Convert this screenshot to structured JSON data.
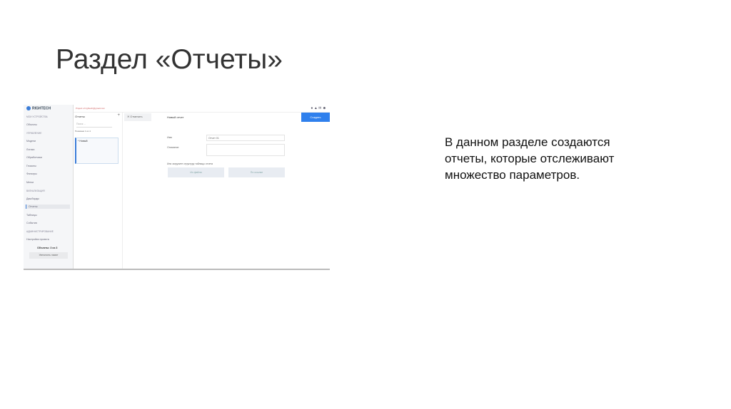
{
  "slide": {
    "title": "Раздел «Отчеты»",
    "description": "В данном разделе создаются отчеты, которые отслеживают множество параметров."
  },
  "app": {
    "logo": "RIGHTECH",
    "project": "Project of rightech@gmail.com",
    "sidebar": {
      "sections": [
        "МОИ УСТРОЙСТВА",
        "УПРАВЛЕНИЕ",
        "ВИЗУАЛИЗАЦИЯ",
        "АДМИНИСТРИРОВАНИЕ"
      ],
      "items": [
        "Объекты",
        "Модели",
        "Логика",
        "Обработчики",
        "Геозоны",
        "Фильтры",
        "Метки",
        "Дашборды",
        "Отчеты",
        "Таблицы",
        "События",
        "Настройки проекта"
      ],
      "objects_count": "Объекты: 3 из 3",
      "limit_button": "Увеличить лимит"
    },
    "list": {
      "title": "Отчеты",
      "search_placeholder": "Поиск ...",
      "shown": "Показано 1 из 1",
      "item": "* Новый"
    },
    "main": {
      "cancel": "Отменить",
      "header": "Новый отчет",
      "create": "Создать",
      "name_label": "Имя",
      "name_value": "Отчет 01",
      "desc_label": "Описание",
      "load_label": "Или загрузите структуру таблицы отчета",
      "from_file": "Из файла",
      "by_link": "По ссылке"
    }
  }
}
